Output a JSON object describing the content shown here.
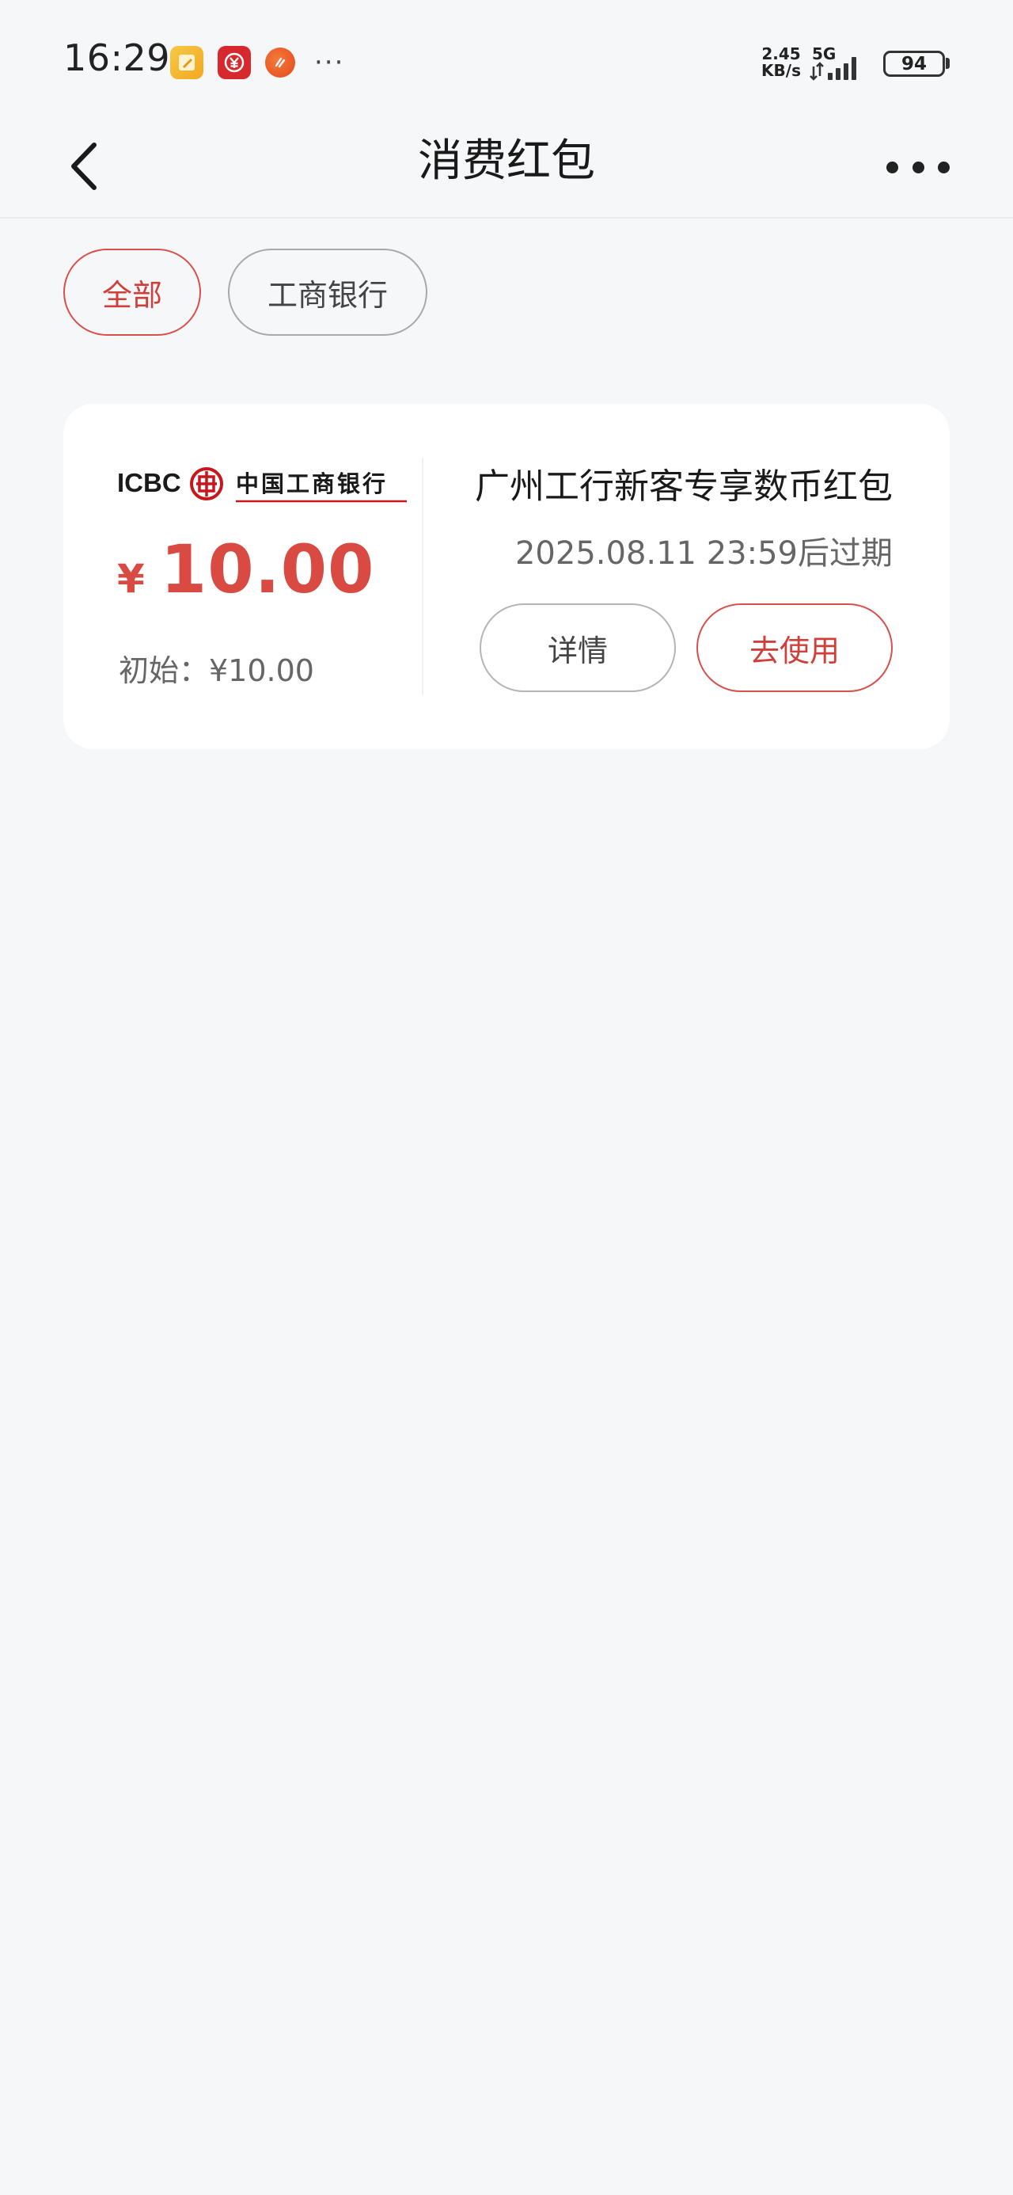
{
  "status_bar": {
    "time": "16:29",
    "net_speed_value": "2.45",
    "net_speed_unit": "KB/s",
    "network_type": "5G",
    "battery": "94",
    "notification_icons": [
      "notes-app-icon",
      "digital-yuan-icon",
      "orange-app-icon"
    ],
    "more_notifications": "···"
  },
  "nav": {
    "title": "消费红包",
    "back_icon": "chevron-left-icon",
    "more_icon": "more-horizontal-icon"
  },
  "filters": {
    "items": [
      {
        "label": "全部",
        "active": true
      },
      {
        "label": "工商银行",
        "active": false
      }
    ]
  },
  "coupon": {
    "bank_logo_text_en": "ICBC",
    "bank_logo_text_cn": "中国工商银行",
    "currency_symbol": "¥",
    "amount": "10.00",
    "original_label": "初始：¥10.00",
    "title": "广州工行新客专享数币红包",
    "expiry": "2025.08.11 23:59后过期",
    "detail_label": "详情",
    "use_label": "去使用"
  },
  "colors": {
    "accent_red": "#d94a42",
    "background": "#f6f7f9",
    "card": "#ffffff"
  }
}
